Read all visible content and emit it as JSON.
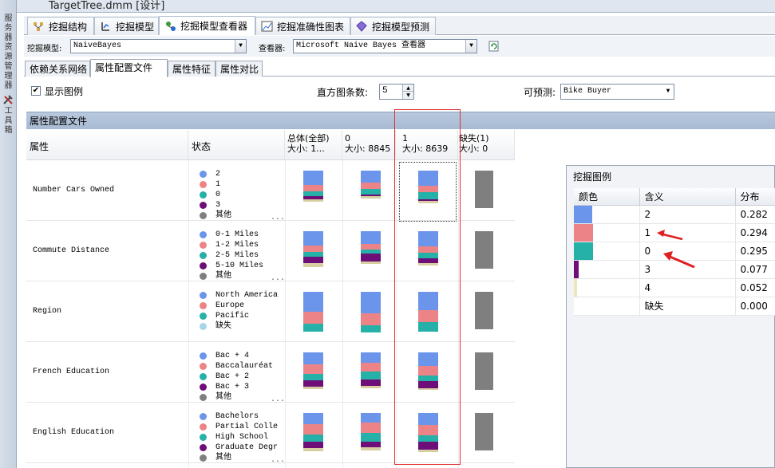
{
  "left_strip": {
    "text_top": "服务器资源管理器",
    "text_bottom": "工具箱"
  },
  "document": {
    "title": "TargetTree.dmm [设计]"
  },
  "main_tabs": [
    {
      "label": "挖掘结构",
      "icon": "mining-structure-icon"
    },
    {
      "label": "挖掘模型",
      "icon": "mining-models-icon"
    },
    {
      "label": "挖掘模型查看器",
      "icon": "model-viewer-icon"
    },
    {
      "label": "挖掘准确性图表",
      "icon": "accuracy-chart-icon"
    },
    {
      "label": "挖掘模型预测",
      "icon": "prediction-icon"
    }
  ],
  "toolbar": {
    "model_label": "挖掘模型:",
    "model_value": "NaiveBayes",
    "viewer_label": "查看器:",
    "viewer_value": "Microsoft Naive Bayes 查看器"
  },
  "sub_tabs": [
    "依赖关系网络",
    "属性配置文件",
    "属性特征",
    "属性对比"
  ],
  "options": {
    "show_legend_label": "显示图例",
    "show_legend_checked": true,
    "histogram_label": "直方图条数:",
    "histogram_value": "5",
    "predictable_label": "可预测:",
    "predictable_value": "Bike Buyer"
  },
  "profile": {
    "section_title": "属性配置文件",
    "headers": {
      "attribute": "属性",
      "state": "状态",
      "col_total_line1": "总体(全部)",
      "col_total_line2": "大小: 1...",
      "col_0_line1": "0",
      "col_0_line2": "大小: 8845",
      "col_1_line1": "1",
      "col_1_line2": "大小: 8639",
      "col_missing_line1": "缺失(1)",
      "col_missing_line2": "大小: 0"
    },
    "rows": [
      {
        "attribute": "Number Cars Owned",
        "states": [
          "2",
          "1",
          "0",
          "3",
          "其他"
        ],
        "has_more": true,
        "dist_total": [
          0.36,
          0.16,
          0.12,
          0.08,
          0.05
        ],
        "dist_0": [
          0.3,
          0.16,
          0.14,
          0.04,
          0.05
        ],
        "dist_1": [
          0.38,
          0.16,
          0.18,
          0.04,
          0.05
        ]
      },
      {
        "attribute": "Commute Distance",
        "states": [
          "0-1 Miles",
          "1-2 Miles",
          "2-5 Miles",
          "5-10 Miles",
          "其他"
        ],
        "has_more": true,
        "dist_total": [
          0.36,
          0.16,
          0.12,
          0.16,
          0.1
        ],
        "dist_0": [
          0.32,
          0.14,
          0.1,
          0.2,
          0.06
        ],
        "dist_1": [
          0.38,
          0.16,
          0.14,
          0.12,
          0.06
        ]
      },
      {
        "attribute": "Region",
        "states": [
          "North America",
          "Europe",
          "Pacific",
          "缺失"
        ],
        "has_more": false,
        "dist_total": [
          0.5,
          0.3,
          0.2
        ],
        "dist_0": [
          0.53,
          0.3,
          0.17
        ],
        "dist_1": [
          0.46,
          0.3,
          0.24
        ]
      },
      {
        "attribute": "French Education",
        "states": [
          "Bac + 4",
          "Baccalauréat",
          "Bac + 2",
          "Bac + 3",
          "其他"
        ],
        "has_more": true,
        "dist_total": [
          0.3,
          0.24,
          0.16,
          0.16,
          0.06
        ],
        "dist_0": [
          0.26,
          0.22,
          0.2,
          0.16,
          0.06
        ],
        "dist_1": [
          0.34,
          0.24,
          0.14,
          0.18,
          0.04
        ]
      },
      {
        "attribute": "English Education",
        "states": [
          "Bachelors",
          "Partial Colle",
          "High School",
          "Graduate Degr",
          "其他"
        ],
        "has_more": true,
        "dist_total": [
          0.28,
          0.26,
          0.18,
          0.16,
          0.08
        ],
        "dist_0": [
          0.24,
          0.26,
          0.22,
          0.14,
          0.08
        ],
        "dist_1": [
          0.3,
          0.26,
          0.16,
          0.2,
          0.05
        ]
      }
    ]
  },
  "legend": {
    "title": "挖掘图例",
    "headers": {
      "color": "颜色",
      "meaning": "含义",
      "distribution": "分布"
    },
    "rows": [
      {
        "color": "#6a95ea",
        "meaning": "2",
        "value": "0.282",
        "share": 0.282
      },
      {
        "color": "#ec8487",
        "meaning": "1",
        "value": "0.294",
        "share": 0.294
      },
      {
        "color": "#25b0a8",
        "meaning": "0",
        "value": "0.295",
        "share": 0.295
      },
      {
        "color": "#6e0e78",
        "meaning": "3",
        "value": "0.077",
        "share": 0.077
      },
      {
        "color": "#efe7bc",
        "meaning": "4",
        "value": "0.052",
        "share": 0.052
      },
      {
        "color": "#ffffff",
        "meaning": "缺失",
        "value": "0.000",
        "share": 0.0
      }
    ]
  },
  "colors": {
    "blue": "#6a95ea",
    "pink": "#ec8487",
    "teal": "#25b0a8",
    "purple": "#6e0e78",
    "grey": "#7f7f7f",
    "beige": "#d8cfa0",
    "lightblue": "#a8d5e6",
    "highlight": "#e03030"
  }
}
